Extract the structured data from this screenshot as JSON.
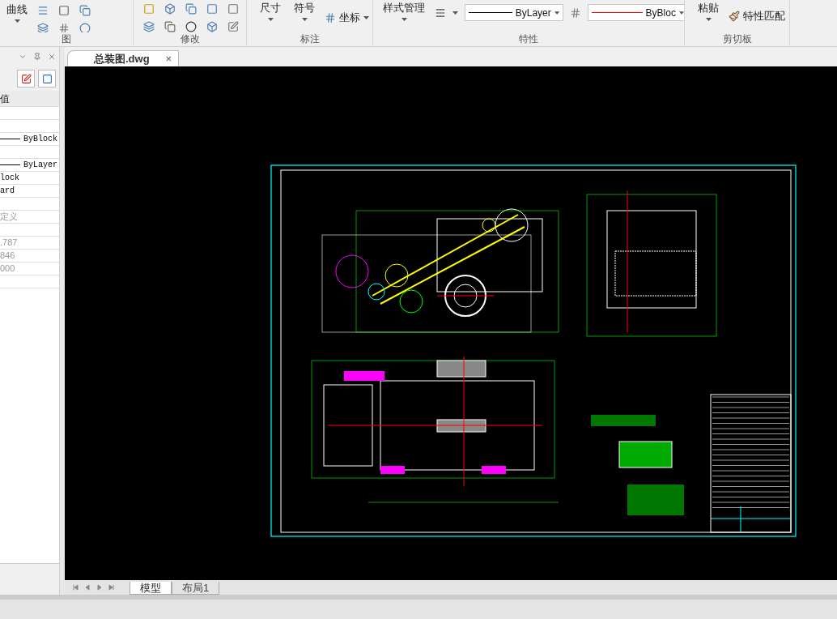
{
  "ribbon": {
    "groups": [
      {
        "label": "图",
        "large": [
          "曲线"
        ]
      },
      {
        "label": "修改"
      },
      {
        "label": "标注",
        "large": [
          "尺寸",
          "符号"
        ],
        "small": [
          "坐标"
        ]
      },
      {
        "label": "特性",
        "large": [
          "样式管理"
        ],
        "linetype": "ByLayer",
        "lineweight": "ByBloc"
      },
      {
        "label": "剪切板",
        "large": [
          "粘贴"
        ],
        "small": [
          "特性匹配"
        ]
      }
    ]
  },
  "properties_panel": {
    "column_header": "值",
    "rows": [
      {
        "kind": "empty"
      },
      {
        "kind": "empty"
      },
      {
        "kind": "line",
        "value": "ByBlock"
      },
      {
        "kind": "empty"
      },
      {
        "kind": "line",
        "value": "ByLayer"
      },
      {
        "kind": "text",
        "value": "lock"
      },
      {
        "kind": "text",
        "value": "ard"
      },
      {
        "kind": "empty"
      },
      {
        "kind": "muted",
        "value": "定义"
      },
      {
        "kind": "empty"
      },
      {
        "kind": "muted",
        "value": ".787"
      },
      {
        "kind": "muted",
        "value": "846"
      },
      {
        "kind": "muted",
        "value": "000"
      },
      {
        "kind": "empty"
      }
    ]
  },
  "document_tab": {
    "title": "总装图.dwg",
    "close": "×"
  },
  "layout_tabs": [
    {
      "label": "模型",
      "selected": true
    },
    {
      "label": "布局1",
      "selected": false
    }
  ]
}
